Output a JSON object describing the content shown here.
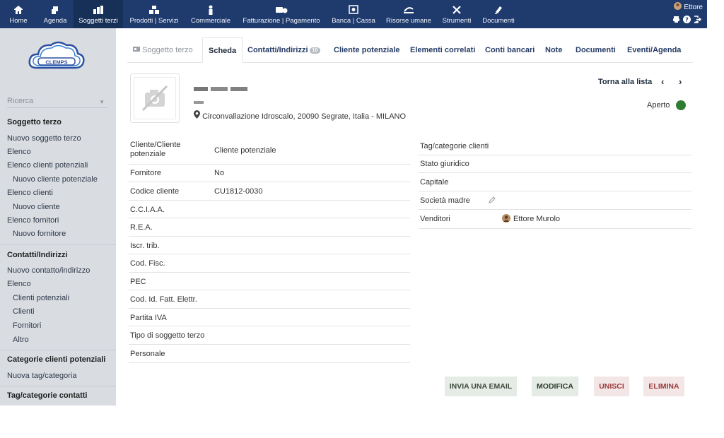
{
  "topnav": {
    "items": [
      {
        "label": "Home",
        "icon": "home-icon"
      },
      {
        "label": "Agenda",
        "icon": "agenda-icon"
      },
      {
        "label": "Soggetti terzi",
        "icon": "companies-icon"
      },
      {
        "label": "Prodotti | Servizi",
        "icon": "products-icon"
      },
      {
        "label": "Commerciale",
        "icon": "commercial-icon"
      },
      {
        "label": "Fatturazione | Pagamento",
        "icon": "billing-icon"
      },
      {
        "label": "Banca | Cassa",
        "icon": "bank-icon"
      },
      {
        "label": "Risorse umane",
        "icon": "hr-icon"
      },
      {
        "label": "Strumenti",
        "icon": "tools-icon"
      },
      {
        "label": "Documenti",
        "icon": "documents-icon"
      }
    ],
    "active": "Soggetti terzi",
    "user": "Ettore"
  },
  "logo": {
    "text": "CLEMPS"
  },
  "sidebar": {
    "search_label": "Ricerca",
    "section1": {
      "title": "Soggetto terzo",
      "items": [
        "Nuovo soggetto terzo",
        "Elenco",
        "Elenco clienti potenziali",
        "Nuovo cliente potenziale",
        "Elenco clienti",
        "Nuovo cliente",
        "Elenco fornitori",
        "Nuovo fornitore"
      ]
    },
    "section2": {
      "title": "Contatti/Indirizzi",
      "items": [
        "Nuovo contatto/indirizzo",
        "Elenco",
        "Clienti potenziali",
        "Clienti",
        "Fornitori",
        "Altro"
      ]
    },
    "section3": {
      "title": "Categorie clienti potenziali",
      "items": [
        "Nuova tag/categoria"
      ]
    },
    "section4": {
      "title": "Tag/categorie contatti"
    }
  },
  "tabs": [
    {
      "label": "Soggetto terzo"
    },
    {
      "label": "Scheda"
    },
    {
      "label": "Contatti/Indirizzi",
      "badge": "10"
    },
    {
      "label": "Cliente potenziale"
    },
    {
      "label": "Elementi correlati"
    },
    {
      "label": "Conti bancari"
    },
    {
      "label": "Note"
    },
    {
      "label": "Documenti"
    },
    {
      "label": "Eventi/Agenda"
    }
  ],
  "record": {
    "address": "Circonvallazione Idroscalo, 20090 Segrate, Italia - MILANO",
    "back_label": "Torna alla lista",
    "prev_arrow": "‹",
    "next_arrow": "›",
    "status": "Aperto",
    "status_color": "#2e7d32"
  },
  "left_fields": [
    {
      "label": "Cliente/Cliente potenziale",
      "value": "Cliente potenziale"
    },
    {
      "label": "Fornitore",
      "value": "No"
    },
    {
      "label": "Codice cliente",
      "value": "CU1812-0030"
    },
    {
      "label": "C.C.I.A.A.",
      "value": ""
    },
    {
      "label": "R.E.A.",
      "value": ""
    },
    {
      "label": "Iscr. trib.",
      "value": ""
    },
    {
      "label": "Cod. Fisc.",
      "value": ""
    },
    {
      "label": "PEC",
      "value": ""
    },
    {
      "label": "Cod. Id. Fatt. Elettr.",
      "value": ""
    },
    {
      "label": "Partita IVA",
      "value": ""
    },
    {
      "label": "Tipo di soggetto terzo",
      "value": ""
    },
    {
      "label": "Personale",
      "value": ""
    }
  ],
  "right_fields": [
    {
      "label": "Tag/categorie clienti",
      "value": ""
    },
    {
      "label": "Stato giuridico",
      "value": ""
    },
    {
      "label": "Capitale",
      "value": ""
    },
    {
      "label": "Società madre",
      "value": ""
    },
    {
      "label": "Venditori",
      "value": "Ettore Murolo"
    }
  ],
  "buttons": {
    "email": "INVIA UNA EMAIL",
    "edit": "MODIFICA",
    "merge": "UNISCI",
    "delete": "ELIMINA"
  },
  "colors": {
    "topbar": "#1f3a6d",
    "sidebar": "#d9dce1",
    "accent_link": "#263c66",
    "delete_text": "#9a3a3a"
  }
}
